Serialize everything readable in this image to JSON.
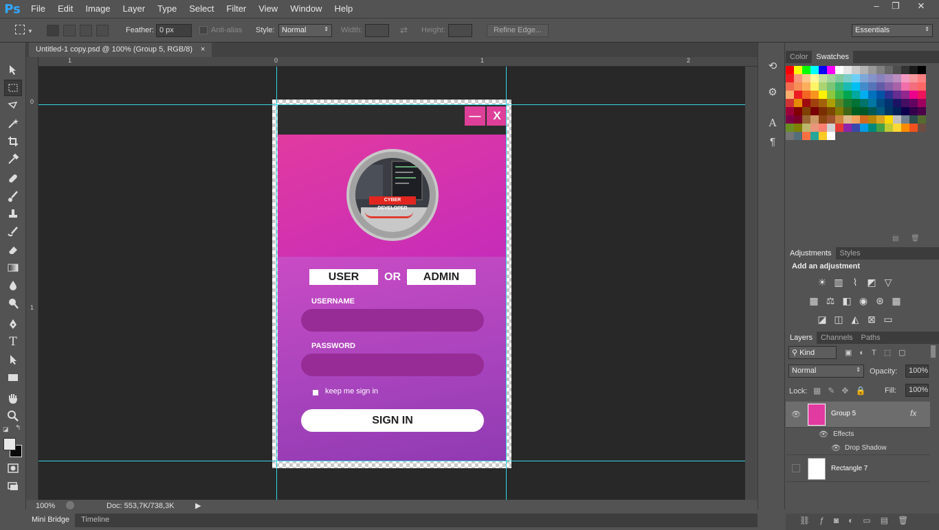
{
  "app": {
    "logo": "Ps"
  },
  "menu": [
    "File",
    "Edit",
    "Image",
    "Layer",
    "Type",
    "Select",
    "Filter",
    "View",
    "Window",
    "Help"
  ],
  "window_controls": {
    "minimize": "–",
    "restore": "❐",
    "close": "✕"
  },
  "options": {
    "feather_label": "Feather:",
    "feather_value": "0 px",
    "antialias_label": "Anti-alias",
    "style_label": "Style:",
    "style_value": "Normal",
    "width_label": "Width:",
    "height_label": "Height:",
    "refine_edge": "Refine Edge...",
    "workspace": "Essentials"
  },
  "document": {
    "tab_title": "Untitled-1 copy.psd @ 100% (Group 5, RGB/8)",
    "tab_close": "×",
    "ruler_h": [
      "1",
      "0",
      "1",
      "2"
    ],
    "ruler_v": [
      "0",
      "1"
    ]
  },
  "status": {
    "zoom": "100%",
    "doc": "Doc: 553,7K/738,3K"
  },
  "bottom_tabs": [
    "Mini Bridge",
    "Timeline"
  ],
  "design": {
    "min_btn": "—",
    "close_btn": "X",
    "avatar_text": "CYBER DEVELOPER",
    "role_user": "USER",
    "role_or": "OR",
    "role_admin": "ADMIN",
    "username_label": "USERNAME",
    "password_label": "PASSWORD",
    "keep_signed": "keep me sign in",
    "signin": "SIGN IN"
  },
  "panels": {
    "color_tabs": [
      "Color",
      "Swatches"
    ],
    "adjust_tabs": [
      "Adjustments",
      "Styles"
    ],
    "add_adjustment": "Add an adjustment",
    "layer_tabs": [
      "Layers",
      "Channels",
      "Paths"
    ],
    "kind": "Kind",
    "blend_mode": "Normal",
    "opacity_label": "Opacity:",
    "opacity_value": "100%",
    "lock_label": "Lock:",
    "fill_label": "Fill:",
    "fill_value": "100%",
    "layers": [
      {
        "name": "Group 5",
        "fx": "fx"
      },
      {
        "name": "Effects"
      },
      {
        "name": "Drop Shadow"
      },
      {
        "name": "Rectangle 7"
      }
    ]
  },
  "swatch_colors": [
    "#ff0000",
    "#ffff00",
    "#00ff00",
    "#00ffff",
    "#0000ff",
    "#ff00ff",
    "#ffffff",
    "#e6e6e6",
    "#cccccc",
    "#b3b3b3",
    "#999999",
    "#808080",
    "#666666",
    "#4d4d4d",
    "#333333",
    "#1a1a1a",
    "#000000",
    "#ed1c24",
    "#f7977a",
    "#fdc68a",
    "#fff79a",
    "#c4df9b",
    "#a3d39c",
    "#82ca9d",
    "#7bcdc8",
    "#6ecff6",
    "#7ea7d8",
    "#8493ca",
    "#8882be",
    "#a187be",
    "#bc8dbf",
    "#f49ac2",
    "#f6989d",
    "#ff8080",
    "#f26c4f",
    "#f68e55",
    "#fbaf5c",
    "#fff467",
    "#acd372",
    "#7cc576",
    "#3bb878",
    "#1abbb4",
    "#00bff3",
    "#438ccb",
    "#5574b9",
    "#605ca8",
    "#8560a8",
    "#a763a8",
    "#f06ea9",
    "#f26d7d",
    "#ff6666",
    "#fcad6d",
    "#ed1c24",
    "#f26522",
    "#f7941d",
    "#fff200",
    "#8dc73f",
    "#39b54a",
    "#00a651",
    "#00a99d",
    "#00aeef",
    "#0072bc",
    "#0054a6",
    "#2e3192",
    "#662d91",
    "#92278f",
    "#ec008c",
    "#ed145b",
    "#d13333",
    "#e68a00",
    "#9e0b0f",
    "#a0410d",
    "#a3620a",
    "#aba000",
    "#598527",
    "#1a7b30",
    "#007236",
    "#00746b",
    "#0076a3",
    "#004b80",
    "#003471",
    "#1b1464",
    "#440e62",
    "#630460",
    "#9e005d",
    "#9e0039",
    "#800000",
    "#804000",
    "#790000",
    "#7b2e00",
    "#7d4900",
    "#827b00",
    "#406618",
    "#005e20",
    "#005826",
    "#005952",
    "#005b7f",
    "#003663",
    "#002157",
    "#0d004c",
    "#32004b",
    "#4b0049",
    "#7b0046",
    "#7a0026",
    "#996633",
    "#cc9966",
    "#8b4513",
    "#a0522d",
    "#cd853f",
    "#deb887",
    "#f4a460",
    "#d2691e",
    "#b8860b",
    "#daa520",
    "#ffd700",
    "#c0c0c0",
    "#708090",
    "#2f4f4f",
    "#556b2f",
    "#6b8e23",
    "#808000",
    "#bdb76b",
    "#e9967a",
    "#fa8072",
    "#d1d1d1",
    "#e53935",
    "#8e24aa",
    "#3949ab",
    "#039be5",
    "#00897b",
    "#43a047",
    "#c0ca33",
    "#fdd835",
    "#fb8c00",
    "#f4511e",
    "#6d4c41",
    "#757575",
    "#546e7a",
    "#ff7043",
    "#26a69a",
    "#ffca28",
    "#ffffff"
  ]
}
